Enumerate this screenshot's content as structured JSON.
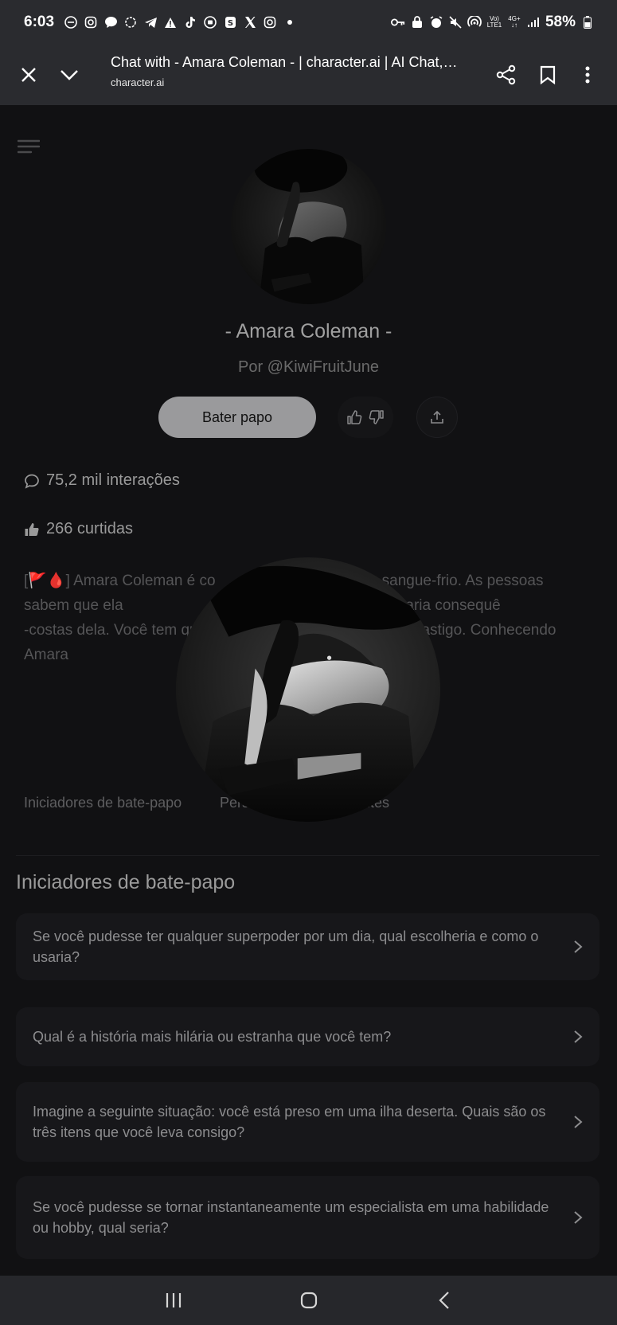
{
  "status_bar": {
    "time": "6:03",
    "battery": "58%"
  },
  "browser": {
    "title": "Chat with - Amara Coleman - | character.ai | AI Chat, Rei...",
    "url": "character.ai"
  },
  "character": {
    "name": "- Amara Coleman -",
    "author": "Por @KiwiFruitJune",
    "chat_button": "Bater papo",
    "interactions": "75,2 mil interações",
    "likes": "266 curtidas",
    "description": "[🚩🩸] Amara Coleman é co                         gância e sangue-frio. As pessoas sabem que ela                                cida — irritá-la significaria consequê                             -costas dela. Você tem que lidar com ela                            castigo. Conhecendo Amara"
  },
  "tabs": [
    "Iniciadores de bate-papo",
    "Pers",
    "ites"
  ],
  "starters": {
    "title": "Iniciadores de bate-papo",
    "items": [
      "Se você pudesse ter qualquer superpoder por um dia, qual escolheria e como o usaria?",
      "Qual é a história mais hilária ou estranha que você tem?",
      "Imagine a seguinte situação: você está preso em uma ilha deserta. Quais são os três itens que você leva consigo?",
      "Se você pudesse se tornar instantaneamente um especialista em uma habilidade ou hobby, qual seria?"
    ]
  },
  "colors": {
    "page_bg": "#111113",
    "bar_bg": "#2a2b2f",
    "chat_button_bg": "#9a9a9c"
  }
}
